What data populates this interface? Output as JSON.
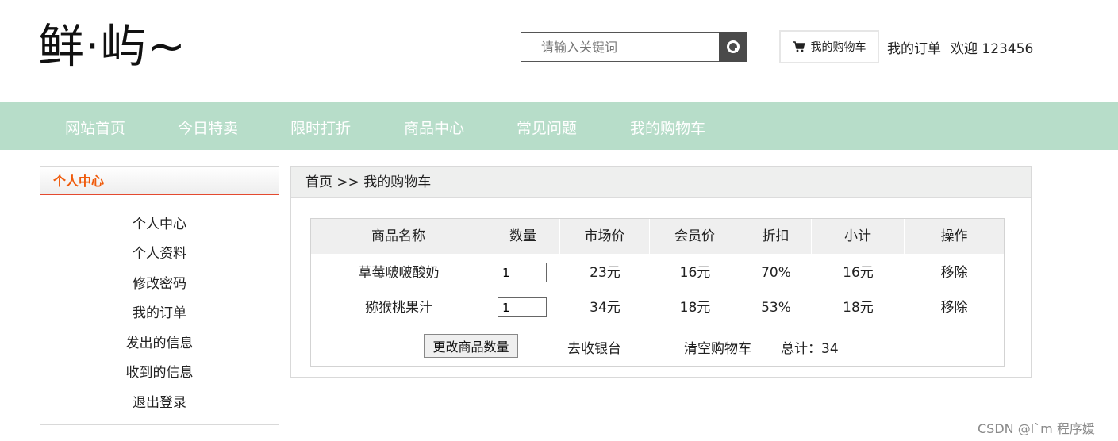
{
  "header": {
    "logo": "鲜·屿~",
    "search_placeholder": "请输入关键词",
    "cart_label": "我的购物车",
    "orders_link": "我的订单",
    "welcome": "欢迎 123456"
  },
  "nav": {
    "items": [
      "网站首页",
      "今日特卖",
      "限时打折",
      "商品中心",
      "常见问题",
      "我的购物车"
    ]
  },
  "sidebar": {
    "title": "个人中心",
    "items": [
      "个人中心",
      "个人资料",
      "修改密码",
      "我的订单",
      "发出的信息",
      "收到的信息",
      "退出登录"
    ]
  },
  "breadcrumb": "首页 >> 我的购物车",
  "cart_table": {
    "headers": [
      "商品名称",
      "数量",
      "市场价",
      "会员价",
      "折扣",
      "小计",
      "操作"
    ],
    "rows": [
      {
        "name": "草莓啵啵酸奶",
        "qty": "1",
        "market_price": "23元",
        "member_price": "16元",
        "discount": "70%",
        "subtotal": "16元",
        "action": "移除"
      },
      {
        "name": "猕猴桃果汁",
        "qty": "1",
        "market_price": "34元",
        "member_price": "18元",
        "discount": "53%",
        "subtotal": "18元",
        "action": "移除"
      }
    ],
    "update_button": "更改商品数量",
    "checkout_link": "去收银台",
    "clear_link": "清空购物车",
    "total": "总计：34"
  },
  "watermark": "CSDN @l`m 程序媛",
  "colors": {
    "nav_bg": "#b7ddc9",
    "sidebar_title": "#ef5a0a",
    "sidebar_underline": "#e44a2f",
    "search_button": "#4a4a4a"
  }
}
